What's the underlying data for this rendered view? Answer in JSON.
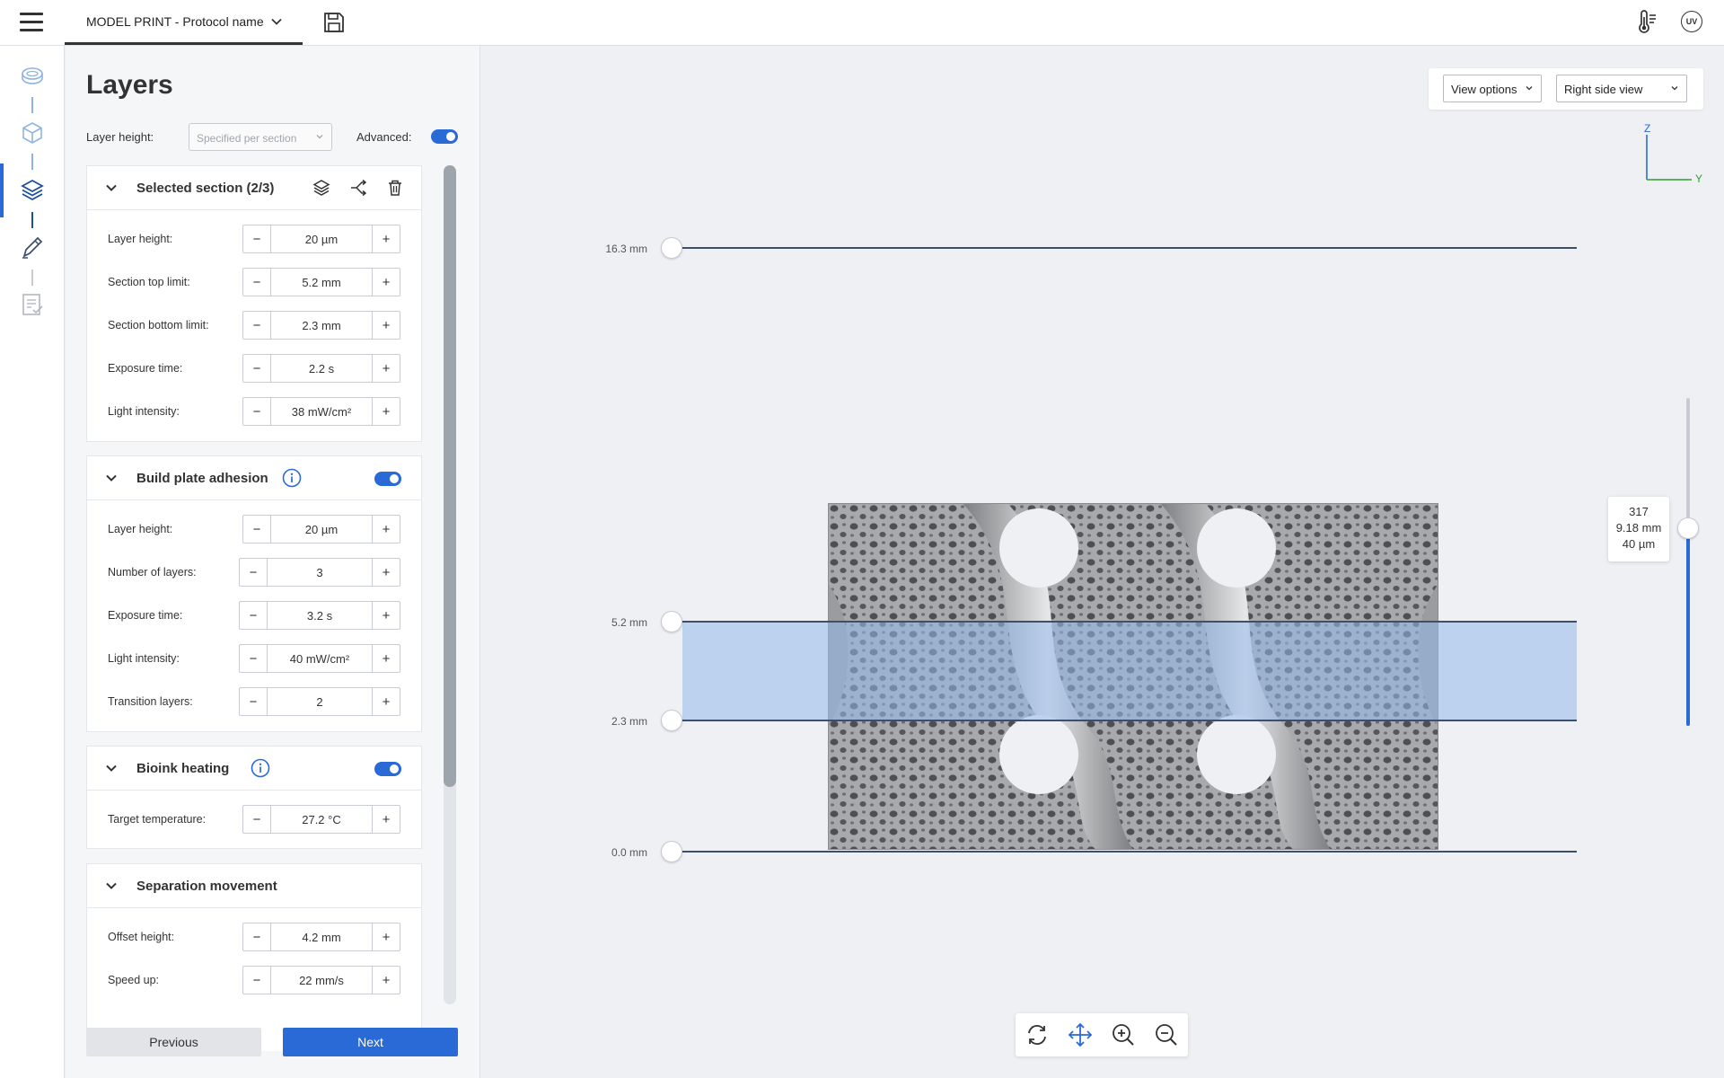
{
  "header": {
    "protocol_tab": "MODEL PRINT - Protocol name",
    "uv_label": "UV"
  },
  "panel": {
    "title": "Layers",
    "layer_height_label": "Layer height:",
    "layer_height_select": "Specified per section",
    "advanced_label": "Advanced:",
    "advanced_on": true
  },
  "sections": {
    "selected": {
      "title": "Selected section (2/3)",
      "rows": [
        {
          "label": "Layer height:",
          "value": "20 µm"
        },
        {
          "label": "Section top limit:",
          "value": "5.2  mm"
        },
        {
          "label": "Section bottom limit:",
          "value": "2.3  mm"
        },
        {
          "label": "Exposure time:",
          "value": "2.2  s"
        },
        {
          "label": "Light intensity:",
          "value": "38  mW/cm²"
        }
      ]
    },
    "adhesion": {
      "title": "Build plate adhesion",
      "enabled": true,
      "rows": [
        {
          "label": "Layer height:",
          "value": "20 µm"
        },
        {
          "label": "Number of layers:",
          "value": "3"
        },
        {
          "label": "Exposure time:",
          "value": "3.2  s"
        },
        {
          "label": "Light intensity:",
          "value": "40  mW/cm²"
        },
        {
          "label": "Transition layers:",
          "value": "2"
        }
      ]
    },
    "heating": {
      "title": "Bioink heating",
      "enabled": true,
      "rows": [
        {
          "label": "Target temperature:",
          "value": "27.2  °C"
        }
      ]
    },
    "separation": {
      "title": "Separation movement",
      "rows": [
        {
          "label": "Offset height:",
          "value": "4.2  mm"
        },
        {
          "label": "Speed up:",
          "value": "22  mm/s"
        }
      ]
    }
  },
  "buttons": {
    "previous": "Previous",
    "next": "Next"
  },
  "viewer": {
    "view_options": "View options",
    "view_side": "Right side view",
    "axis_z": "Z",
    "axis_y": "Y",
    "levels": {
      "top": "16.3 mm",
      "section_top": "5.2 mm",
      "section_bottom": "2.3 mm",
      "bottom": "0.0 mm"
    },
    "slider": {
      "layer": "317",
      "height": "9.18 mm",
      "thickness": "40 µm"
    }
  },
  "colors": {
    "accent": "#2a6ad6",
    "line": "#3d4f6b",
    "band": "#96b9eb"
  }
}
